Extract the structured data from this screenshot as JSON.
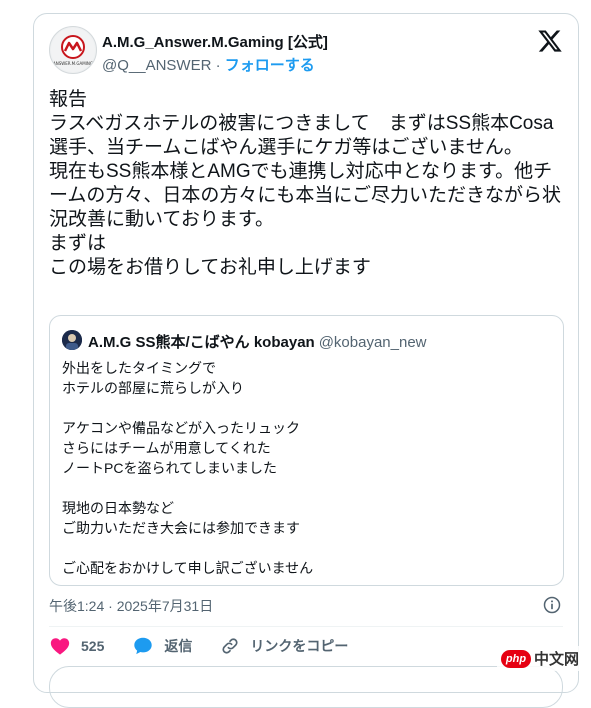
{
  "tweet": {
    "display_name": "A.M.G_Answer.M.Gaming [公式]",
    "handle": "@Q__ANSWER",
    "separator": " · ",
    "follow_label": "フォローする",
    "avatar_text": "ANSWER.M.GAMING",
    "text": "報告\nラスベガスホテルの被害につきまして　まずはSS熊本Cosa選手、当チームこばやん選手にケガ等はございません。\n現在もSS熊本様とAMGでも連携し対応中となります。他チームの方々、日本の方々にも本当にご尽力いただきながら状況改善に動いております。\nまずは\nこの場をお借りしてお礼申し上げます",
    "timestamp": "午後1:24 · 2025年7月31日"
  },
  "quote": {
    "display_name": "A.M.G SS熊本/こばやん kobayan",
    "handle": "@kobayan_new",
    "text": "外出をしたタイミングで\nホテルの部屋に荒らしが入り\n\nアケコンや備品などが入ったリュック\nさらにはチームが用意してくれた\nノートPCを盗られてしまいました\n\n現地の日本勢など\nご助力いただき大会には参加できます\n\nご心配をおかけして申し訳ございません"
  },
  "actions": {
    "like_count": "525",
    "reply_label": "返信",
    "copy_link_label": "リンクをコピー"
  },
  "icons": {
    "x_logo": "x-logo-icon",
    "info": "info-icon",
    "like": "heart-icon",
    "reply": "reply-icon",
    "link": "link-icon"
  },
  "colors": {
    "like": "#f91880",
    "reply": "#1d9bf0",
    "accent": "#1d9bf0",
    "secondary_text": "#536471",
    "border": "#cfd9de"
  },
  "watermark": {
    "logo": "php",
    "text": "中文网"
  }
}
